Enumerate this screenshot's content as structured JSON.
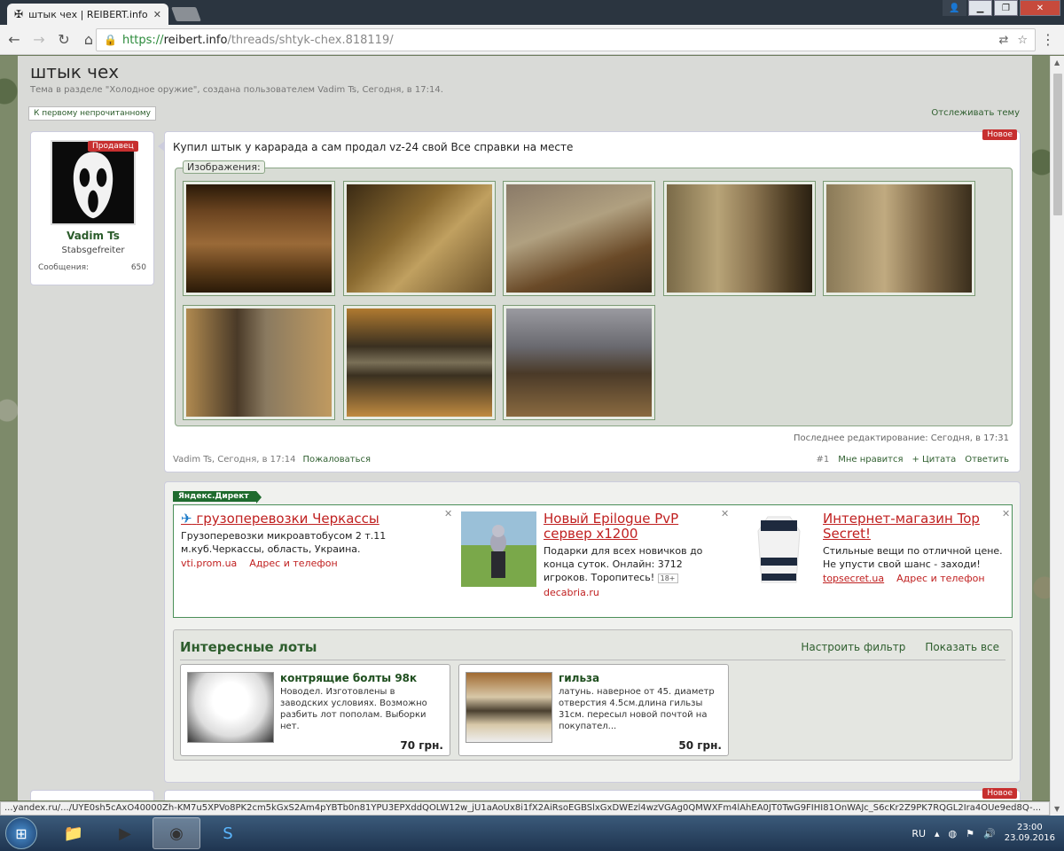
{
  "browser": {
    "tab_title": "штык чех | REIBERT.info",
    "url_https": "https://",
    "url_host": "reibert.info",
    "url_path": "/threads/shtyk-chex.818119/"
  },
  "thread": {
    "title": "штык чех",
    "meta": "Тема в разделе \"Холодное оружие\", создана пользователем Vadim Ts, Сегодня, в 17:14.",
    "unread_button": "К первому непрочитанному",
    "watch_link": "Отслеживать тему"
  },
  "user": {
    "badge": "Продавец",
    "name": "Vadim Ts",
    "rank": "Stabsgefreiter",
    "messages_label": "Сообщения:",
    "messages_count": "650"
  },
  "post": {
    "new_badge": "Новое",
    "text": "Купил штык у карарада а сам продал vz-24 свой Все справки на месте",
    "images_label": "Изображения:",
    "edited": "Последнее редактирование: Сегодня, в 17:31",
    "author_time": "Vadim Ts, Сегодня, в 17:14",
    "report": "Пожаловаться",
    "number": "#1",
    "like": "Мне нравится",
    "quote": "+ Цитата",
    "reply": "Ответить"
  },
  "direct": {
    "label": "Яндекс.Директ",
    "ads": [
      {
        "title": "грузоперевозки Черкассы",
        "body": "Грузоперевозки микроавтобусом 2 т.11 м.куб.Черкассы, область, Украина.",
        "domain": "vti.prom.ua",
        "link": "Адрес и телефон"
      },
      {
        "title": "Новый Epilogue PvP сервер x1200",
        "body": "Подарки для всех новичков до конца суток. Онлайн: 3712 игроков. Торопитесь!",
        "age": "18+",
        "domain": "decabria.ru"
      },
      {
        "title": "Интернет-магазин Top Secret!",
        "body": "Стильные вещи по отличной цене. Не упусти свой шанс - заходи!",
        "domain": "topsecret.ua",
        "link": "Адрес и телефон"
      }
    ]
  },
  "lots": {
    "title": "Интересные лоты",
    "filter": "Настроить фильтр",
    "show_all": "Показать все",
    "items": [
      {
        "name": "контрящие болты 98к",
        "desc": "Новодел. Изготовлены в заводских условиях. Возможно разбить лот пополам. Выборки нет.",
        "price": "70 грн."
      },
      {
        "name": "гильза",
        "desc": "латунь. наверное от 45. диаметр отверстия 4.5см.длина гильзы 31см. пересыл новой почтой на покупател...",
        "price": "50 грн."
      }
    ]
  },
  "next_post_badge": "Новое",
  "status_url": "...yandex.ru/.../UYE0sh5cAxO40000Zh-KM7u5XPVo8PK2cm5kGxS2Am4pYBTb0n81YPU3EPXddQOLW12w_jU1aAoUx8i1fX2AiRsoEGBSlxGxDWEzl4wzVGAg0QMWXFm4lAhEA0JT0TwG9FIHI81OnWAJc_S6cKr2Z9PK7RQGL2Ira4OUe9ed8Q-...",
  "taskbar": {
    "lang": "RU",
    "time": "23:00",
    "date": "23.09.2016"
  }
}
